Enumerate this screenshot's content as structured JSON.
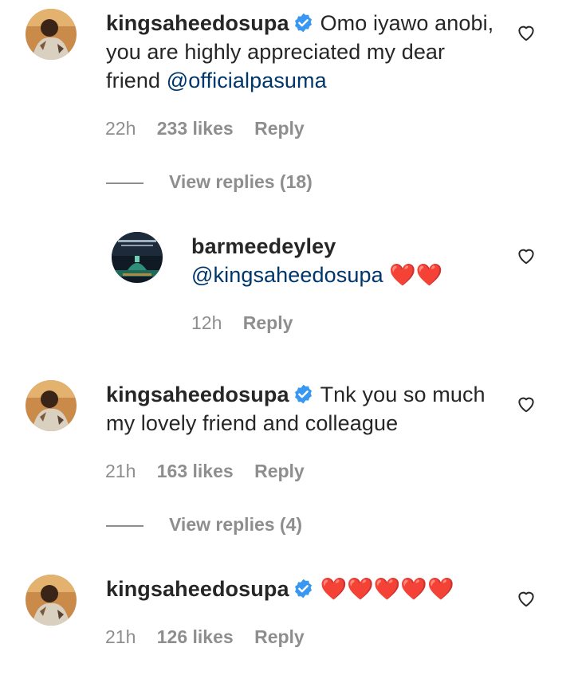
{
  "comments": [
    {
      "username": "kingsaheedosupa",
      "verified": true,
      "text": "Omo iyawo anobi, you are highly appreciated my dear friend",
      "mention": "@officialpasuma",
      "time": "22h",
      "likes": "233 likes",
      "reply_label": "Reply",
      "view_replies": "View replies (18)"
    },
    {
      "username": "barmeedeyley",
      "verified": false,
      "mention": "@kingsaheedosupa",
      "hearts": "❤️❤️",
      "time": "12h",
      "reply_label": "Reply"
    },
    {
      "username": "kingsaheedosupa",
      "verified": true,
      "text": "Tnk you so much my lovely friend and colleague",
      "time": "21h",
      "likes": "163 likes",
      "reply_label": "Reply",
      "view_replies": "View replies (4)"
    },
    {
      "username": "kingsaheedosupa",
      "verified": true,
      "hearts": "❤️❤️❤️❤️❤️",
      "time": "21h",
      "likes": "126 likes",
      "reply_label": "Reply"
    }
  ],
  "icons": {
    "like": "heart-outline-icon",
    "verified": "verified-badge-icon"
  },
  "colors": {
    "text": "#262626",
    "secondary": "#8e8e8e",
    "mention": "#00376b",
    "verified": "#3897f0",
    "heart": "#e0142a"
  }
}
